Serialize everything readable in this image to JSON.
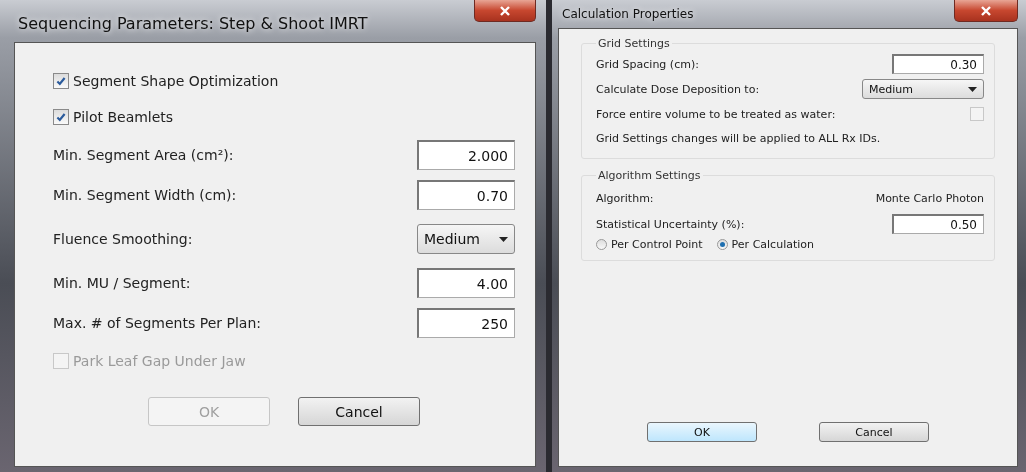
{
  "dialogs": [
    {
      "title": "Sequencing Parameters: Step & Shoot IMRT",
      "rows": [
        {
          "kind": "checkbox",
          "label": "Segment Shape Optimization",
          "checked": true,
          "disabled": false
        },
        {
          "kind": "checkbox",
          "label": "Pilot Beamlets",
          "checked": true,
          "disabled": false
        },
        {
          "kind": "input",
          "label": "Min. Segment Area (cm²):",
          "value": "2.000"
        },
        {
          "kind": "input",
          "label": "Min. Segment Width (cm):",
          "value": "0.70"
        },
        {
          "kind": "select",
          "label": "Fluence Smoothing:",
          "value": "Medium"
        },
        {
          "kind": "input",
          "label": "Min. MU / Segment:",
          "value": "4.00"
        },
        {
          "kind": "input",
          "label": "Max. # of Segments Per Plan:",
          "value": "250"
        },
        {
          "kind": "checkbox",
          "label": "Park Leaf Gap Under Jaw",
          "checked": false,
          "disabled": true
        }
      ],
      "buttons": [
        {
          "label": "OK",
          "disabled": true
        },
        {
          "label": "Cancel",
          "disabled": false
        }
      ]
    },
    {
      "title": "Calculation Properties",
      "groups": [
        {
          "title": "Grid Settings",
          "rows": [
            {
              "kind": "input",
              "label": "Grid Spacing (cm):",
              "value": "0.30"
            },
            {
              "kind": "select",
              "label": "Calculate Dose Deposition to:",
              "value": "Medium"
            },
            {
              "kind": "checkbox",
              "label": "Force entire volume to be treated as water:",
              "checked": false,
              "disabled": true
            },
            {
              "kind": "note",
              "label": "Grid Settings changes will be applied to ALL Rx IDs."
            }
          ]
        },
        {
          "title": "Algorithm Settings",
          "rows": [
            {
              "kind": "info",
              "label": "Algorithm:",
              "value": "Monte Carlo Photon"
            },
            {
              "kind": "input",
              "label": "Statistical Uncertainty (%):",
              "value": "0.50"
            },
            {
              "kind": "radios",
              "options": [
                {
                  "label": "Per Control Point",
                  "selected": false
                },
                {
                  "label": "Per Calculation",
                  "selected": true
                }
              ]
            }
          ]
        }
      ],
      "buttons": [
        {
          "label": "OK",
          "disabled": false
        },
        {
          "label": "Cancel",
          "disabled": false
        }
      ]
    }
  ]
}
